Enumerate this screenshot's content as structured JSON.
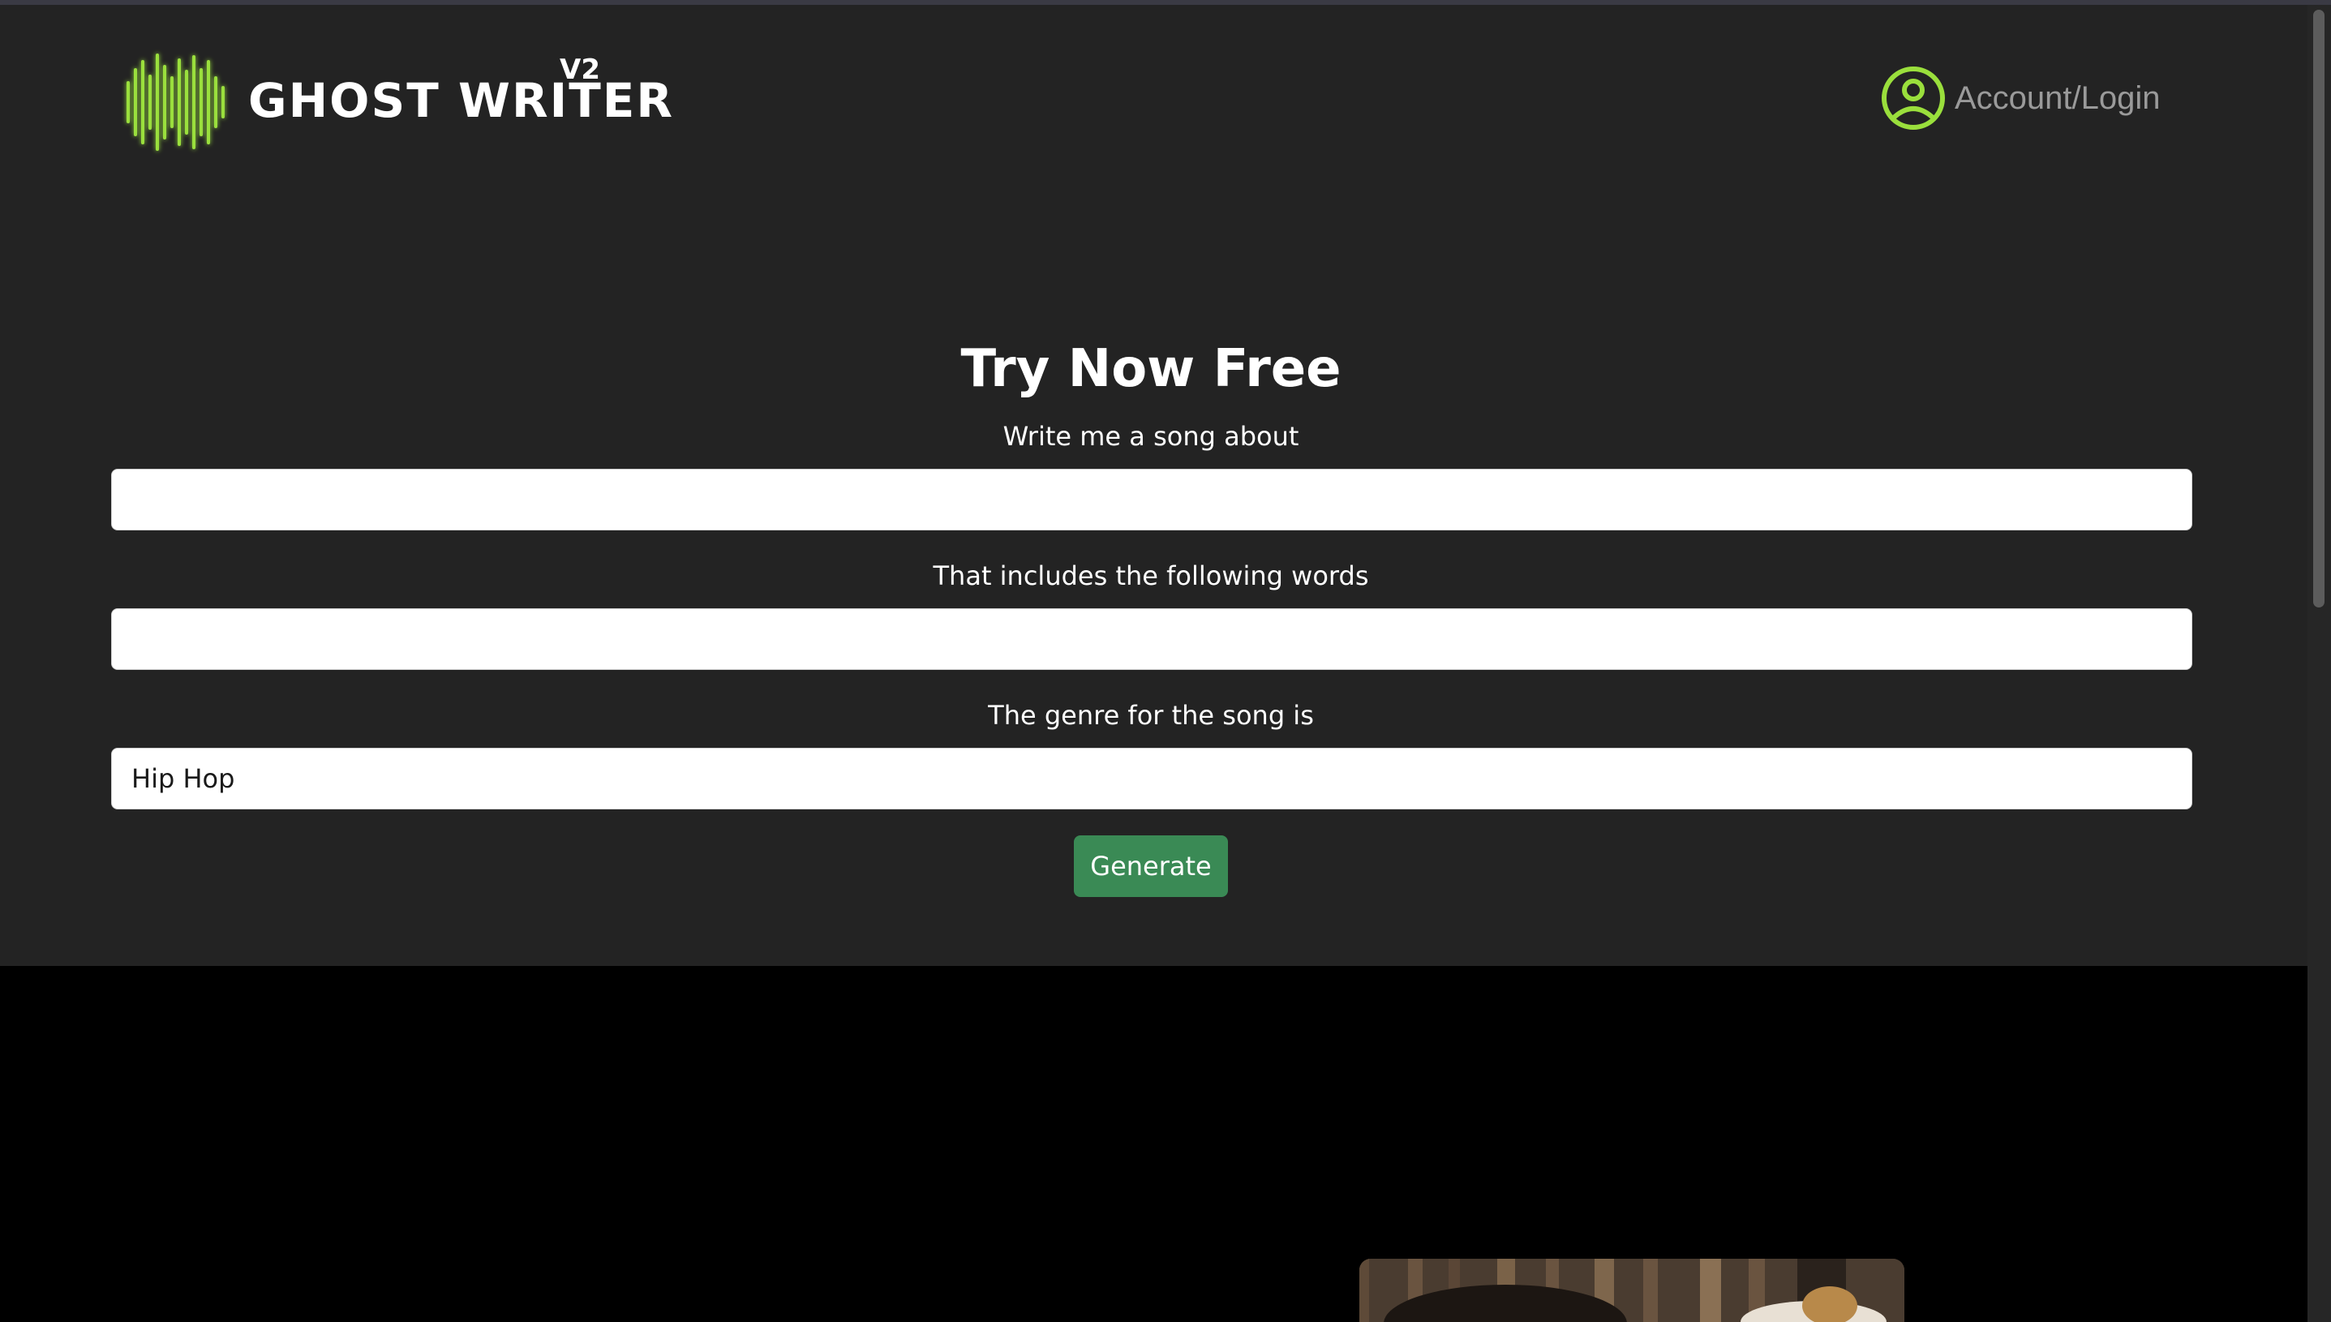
{
  "header": {
    "logo_text": "GHOST WRITER",
    "logo_version": "V2",
    "account_label": "Account/Login"
  },
  "form": {
    "title": "Try Now Free",
    "topic_label": "Write me a song about",
    "topic_value": "",
    "words_label": "That includes the following words",
    "words_value": "",
    "genre_label": "The genre for the song is",
    "genre_value": "Hip Hop",
    "submit_label": "Generate"
  },
  "colors": {
    "hero_bg": "#232323",
    "lower_bg": "#000000",
    "accent_green": "#9adf3c",
    "button_green": "#3a8a55",
    "account_text": "#9a9a9a"
  },
  "icons": {
    "logo": "sound-wave-icon",
    "account": "user-circle-icon"
  }
}
